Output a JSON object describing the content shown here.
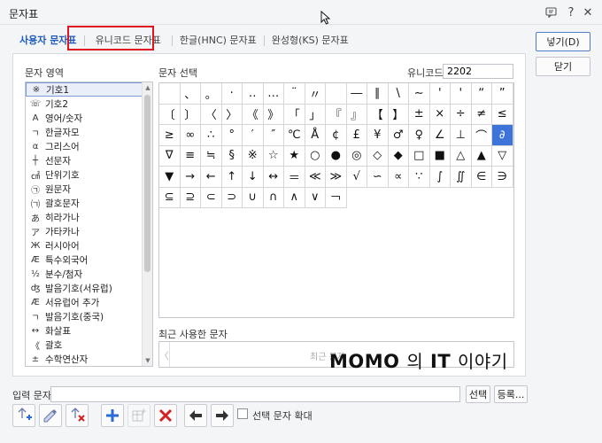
{
  "window": {
    "title": "문자표"
  },
  "tabs": [
    {
      "label": "사용자 문자표"
    },
    {
      "label": "유니코드 문자표"
    },
    {
      "label": "한글(HNC) 문자표"
    },
    {
      "label": "완성형(KS) 문자표"
    }
  ],
  "labels": {
    "area": "문자 영역",
    "select": "문자 선택",
    "unicode": "유니코드",
    "recent": "최근 사용한 문자",
    "input": "입력 문자",
    "show_large": "선택 문자 확대"
  },
  "unicode_value": "2202",
  "recent_empty": "최근 문자",
  "buttons": {
    "insert": "넣기(D)",
    "close": "닫기",
    "select": "선택",
    "register": "등록..."
  },
  "categories": [
    {
      "icon": "※",
      "label": "기호1"
    },
    {
      "icon": "☏",
      "label": "기호2"
    },
    {
      "icon": "A",
      "label": "영어/숫자"
    },
    {
      "icon": "ㄱ",
      "label": "한글자모"
    },
    {
      "icon": "α",
      "label": "그리스어"
    },
    {
      "icon": "┼",
      "label": "선문자"
    },
    {
      "icon": "㎠",
      "label": "단위기호"
    },
    {
      "icon": "㉠",
      "label": "원문자"
    },
    {
      "icon": "㈀",
      "label": "괄호문자"
    },
    {
      "icon": "あ",
      "label": "히라가나"
    },
    {
      "icon": "ア",
      "label": "가타카나"
    },
    {
      "icon": "Ж",
      "label": "러시아어"
    },
    {
      "icon": "Æ",
      "label": "특수외국어"
    },
    {
      "icon": "½",
      "label": "분수/첨자"
    },
    {
      "icon": "ʤ",
      "label": "발음기호(서유럽)"
    },
    {
      "icon": "Æ",
      "label": "서유럽어 추가"
    },
    {
      "icon": "ㄱ",
      "label": "발음기호(중국)"
    },
    {
      "icon": "↔",
      "label": "화살표"
    },
    {
      "icon": "《",
      "label": "괄호"
    },
    {
      "icon": "±",
      "label": "수학연산자"
    }
  ],
  "selected_category_index": 0,
  "symbols": [
    "",
    "、",
    "。",
    "·",
    "‥",
    "…",
    "¨",
    "〃",
    "",
    "―",
    "∥",
    "\\",
    "∼",
    "'",
    "'",
    "“",
    "”",
    "〔",
    "〕",
    "〈",
    "〉",
    "《",
    "》",
    "「",
    "」",
    "『",
    "』",
    "【",
    "】",
    "±",
    "×",
    "÷",
    "≠",
    "≤",
    "≥",
    "∞",
    "∴",
    "°",
    "′",
    "″",
    "℃",
    "Å",
    "¢",
    "£",
    "¥",
    "♂",
    "♀",
    "∠",
    "⊥",
    "⌒",
    "∂",
    "∇",
    "≡",
    "≒",
    "§",
    "※",
    "☆",
    "★",
    "○",
    "●",
    "◎",
    "◇",
    "◆",
    "□",
    "■",
    "△",
    "▲",
    "▽",
    "▼",
    "→",
    "←",
    "↑",
    "↓",
    "↔",
    "＝",
    "≪",
    "≫",
    "√",
    "∽",
    "∝",
    "∵",
    "∫",
    "∬",
    "∈",
    "∋",
    "⊆",
    "⊇",
    "⊂",
    "⊃",
    "∪",
    "∩",
    "∧",
    "∨",
    "￢"
  ],
  "selected_symbol_index": 50,
  "watermark": {
    "brand": "MOMO",
    "mid": "의",
    "it": "IT",
    "tail": "이야기"
  },
  "icons": {
    "help": "help-icon",
    "close": "close-icon"
  }
}
